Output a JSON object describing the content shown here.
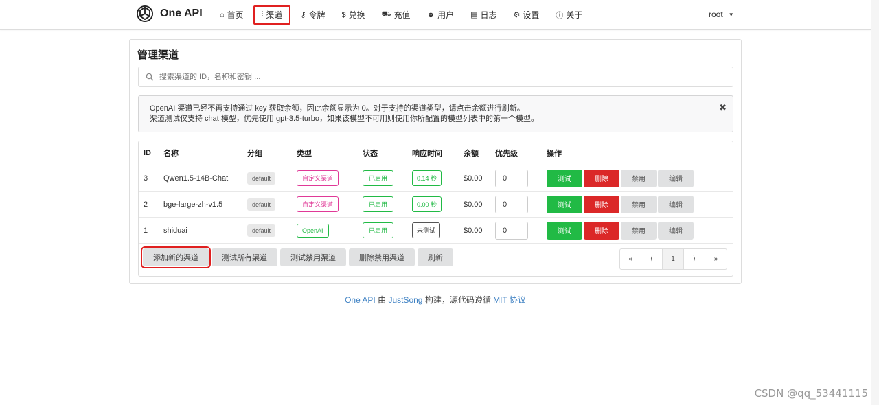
{
  "app": {
    "logo_text": "One API",
    "user": "root"
  },
  "nav": [
    {
      "icon": "home-icon",
      "glyph": "⌂",
      "label": "首页"
    },
    {
      "icon": "sitemap-icon",
      "glyph": "⫶",
      "label": "渠道",
      "active": true
    },
    {
      "icon": "key-icon",
      "glyph": "⚷",
      "label": "令牌"
    },
    {
      "icon": "dollar-icon",
      "glyph": "$",
      "label": "兑换"
    },
    {
      "icon": "cart-icon",
      "glyph": "⛟",
      "label": "充值"
    },
    {
      "icon": "user-icon",
      "glyph": "☻",
      "label": "用户"
    },
    {
      "icon": "book-icon",
      "glyph": "▤",
      "label": "日志"
    },
    {
      "icon": "gear-icon",
      "glyph": "⚙",
      "label": "设置"
    },
    {
      "icon": "info-icon",
      "glyph": "ⓘ",
      "label": "关于"
    }
  ],
  "page": {
    "title": "管理渠道",
    "search_placeholder": "搜索渠道的 ID，名称和密钥 ...",
    "notice_line1": "OpenAI 渠道已经不再支持通过 key 获取余额，因此余额显示为 0。对于支持的渠道类型，请点击余额进行刷新。",
    "notice_line2": "渠道测试仅支持 chat 模型，优先使用 gpt-3.5-turbo，如果该模型不可用则使用你所配置的模型列表中的第一个模型。",
    "notice_close": "✖"
  },
  "table": {
    "headers": {
      "id": "ID",
      "name": "名称",
      "group": "分组",
      "type": "类型",
      "status": "状态",
      "response": "响应时间",
      "balance": "余额",
      "priority": "优先级",
      "actions": "操作"
    },
    "rows": [
      {
        "id": "3",
        "name": "Qwen1.5-14B-Chat",
        "group": "default",
        "type": "自定义渠道",
        "status": "已启用",
        "response": "0.14 秒",
        "balance": "$0.00",
        "priority": "0"
      },
      {
        "id": "2",
        "name": "bge-large-zh-v1.5",
        "group": "default",
        "type": "自定义渠道",
        "status": "已启用",
        "response": "0.00 秒",
        "balance": "$0.00",
        "priority": "0"
      },
      {
        "id": "1",
        "name": "shiduai",
        "group": "default",
        "type": "OpenAI",
        "status": "已启用",
        "response": "未测试",
        "balance": "$0.00",
        "priority": "0"
      }
    ],
    "actions": {
      "test": "测试",
      "delete": "删除",
      "disable": "禁用",
      "edit": "编辑"
    }
  },
  "footer_buttons": {
    "add": "添加新的渠道",
    "test_all": "测试所有渠道",
    "test_disabled": "测试禁用渠道",
    "delete_disabled": "删除禁用渠道",
    "refresh": "刷新"
  },
  "pagination": {
    "first": "«",
    "prev": "⟨",
    "current": "1",
    "next": "⟩",
    "last": "»"
  },
  "footer": {
    "p1": "One API",
    "p2": " 由 ",
    "p3": "JustSong",
    "p4": " 构建，源代码遵循 ",
    "p5": "MIT 协议"
  },
  "watermark": "CSDN @qq_53441115"
}
